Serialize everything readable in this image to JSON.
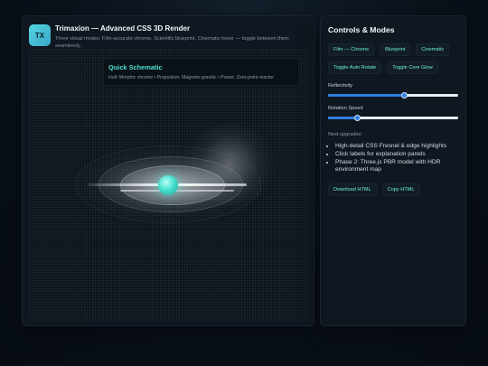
{
  "header": {
    "logo_text": "TX",
    "title": "Trimaxion — Advanced CSS 3D Render",
    "subtitle": "Three visual modes: Film-accurate chrome, Scientific blueprint, Cinematic hover — toggle between them seamlessly."
  },
  "schematic": {
    "title": "Quick Schematic",
    "specs": "Hull: Morphic chrome • Propulsion: Magneto-gravitic • Power: Zero-point reactor"
  },
  "controls": {
    "title": "Controls & Modes",
    "mode_buttons": [
      "Film — Chrome",
      "Blueprint",
      "Cinematic"
    ],
    "toggle_buttons": [
      "Toggle Auto Rotate",
      "Toggle Core Glow"
    ],
    "reflectivity": {
      "label": "Reflectivity",
      "value": 0.58
    },
    "rotation": {
      "label": "Rotation Speed",
      "value": 0.22
    },
    "next_label": "Next upgrades:",
    "upgrades": [
      "High-detail CSS Fresnel & edge highlights",
      "Click labels for explanation panels",
      "Phase 2: Three.js PBR model with HDR environment map"
    ],
    "download_label": "Download HTML",
    "copy_label": "Copy HTML"
  },
  "colors": {
    "accent": "#6ff1df",
    "slider": "#2f7ee0",
    "core": "#48e0cf"
  },
  "icons": {
    "logo": "tx-logo-icon"
  }
}
